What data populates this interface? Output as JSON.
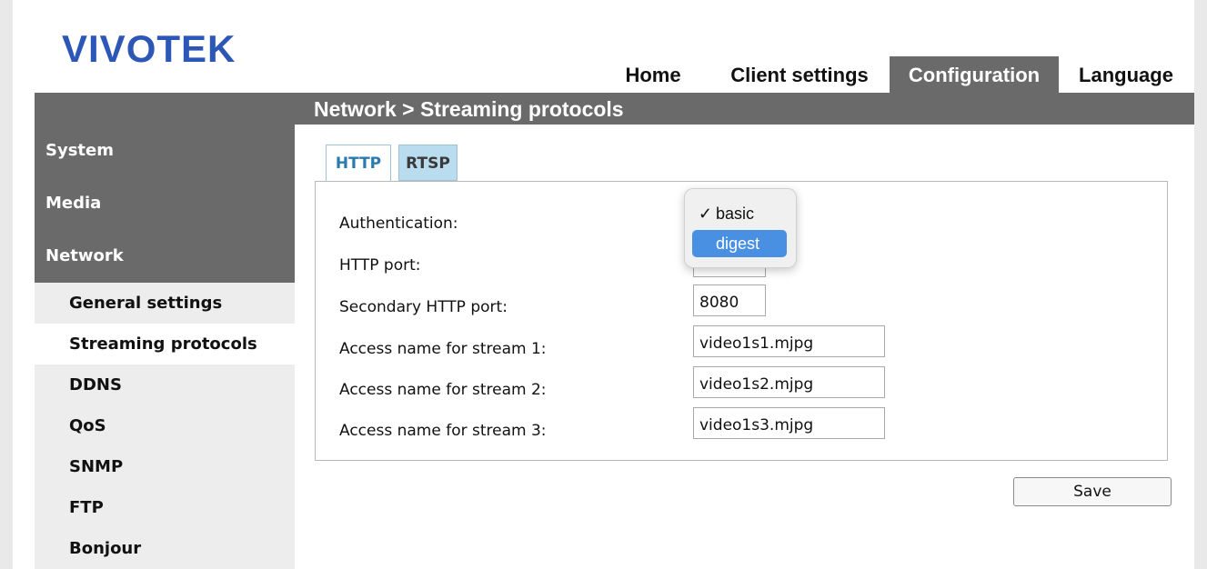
{
  "brand": {
    "logo": "VIVOTEK",
    "color": "#2c57b7"
  },
  "nav": {
    "items": [
      {
        "label": "Home"
      },
      {
        "label": "Client settings"
      },
      {
        "label": "Configuration",
        "active": true
      },
      {
        "label": "Language"
      }
    ]
  },
  "breadcrumb": "Network  > Streaming protocols",
  "sidebar": {
    "main": [
      {
        "label": "System"
      },
      {
        "label": "Media"
      },
      {
        "label": "Network",
        "active": true
      }
    ],
    "sub": [
      {
        "label": "General settings"
      },
      {
        "label": "Streaming protocols",
        "active": true
      },
      {
        "label": "DDNS"
      },
      {
        "label": "QoS"
      },
      {
        "label": "SNMP"
      },
      {
        "label": "FTP"
      },
      {
        "label": "Bonjour"
      }
    ]
  },
  "tabs": [
    {
      "label": "HTTP",
      "active": true
    },
    {
      "label": "RTSP"
    }
  ],
  "form": {
    "auth_label": "Authentication:",
    "auth_options": [
      "basic",
      "digest"
    ],
    "auth_checked": "basic",
    "auth_highlighted": "digest",
    "http_port_label": "HTTP port:",
    "http_port_value": "",
    "secondary_port_label": "Secondary HTTP port:",
    "secondary_port_value": "8080",
    "stream1_label": "Access name for stream 1:",
    "stream1_value": "video1s1.mjpg",
    "stream2_label": "Access name for stream 2:",
    "stream2_value": "video1s2.mjpg",
    "stream3_label": "Access name for stream 3:",
    "stream3_value": "video1s3.mjpg"
  },
  "save_label": "Save",
  "colors": {
    "header_gray": "#6a6a6a",
    "tab_active_text": "#2a7ab0",
    "tab_inactive_bg": "#b9dcef",
    "dropdown_highlight": "#4a90e2"
  },
  "icons": {
    "check": "checkmark-icon"
  }
}
